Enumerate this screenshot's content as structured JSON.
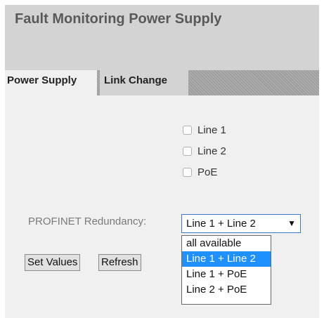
{
  "header": {
    "title": "Fault Monitoring Power Supply"
  },
  "tabs": [
    {
      "label": "Power Supply",
      "active": true
    },
    {
      "label": "Link Change",
      "active": false
    }
  ],
  "checkboxes": [
    {
      "label": "Line 1",
      "checked": false
    },
    {
      "label": "Line 2",
      "checked": false
    },
    {
      "label": "PoE",
      "checked": false
    }
  ],
  "redundancy": {
    "label": "PROFINET Redundancy:",
    "selected": "Line 1 + Line 2",
    "options": [
      "all available",
      "Line 1 + Line 2",
      "Line 1 + PoE",
      "Line 2 + PoE"
    ],
    "highlighted_index": 1
  },
  "buttons": {
    "set_values": "Set Values",
    "refresh": "Refresh"
  },
  "colors": {
    "title_bar": "#d3d3d3",
    "panel": "#f0f0f0",
    "highlight": "#1e90ff",
    "focus_border": "#3c78d8"
  }
}
